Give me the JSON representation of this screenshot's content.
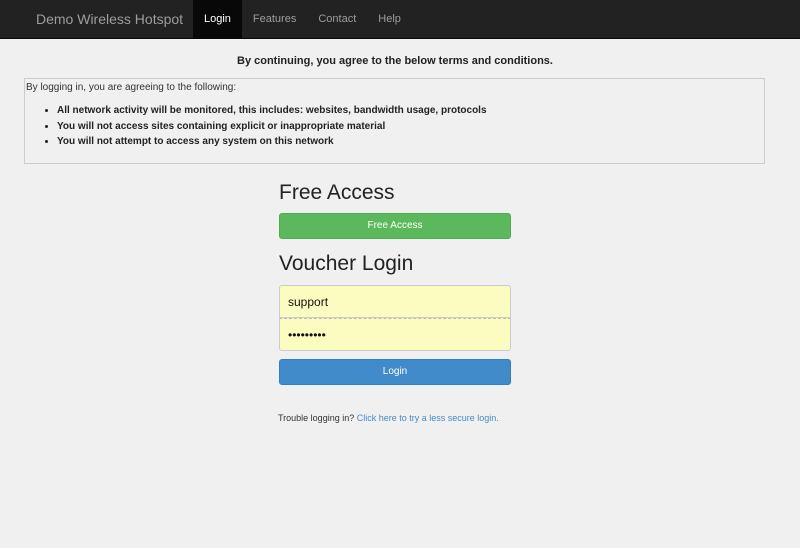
{
  "navbar": {
    "brand": "Demo Wireless Hotspot",
    "items": [
      {
        "label": "Login",
        "active": true
      },
      {
        "label": "Features",
        "active": false
      },
      {
        "label": "Contact",
        "active": false
      },
      {
        "label": "Help",
        "active": false
      }
    ]
  },
  "terms": {
    "heading": "By continuing, you agree to the below terms and conditions.",
    "intro": "By logging in, you are agreeing to the following:",
    "items": [
      "All network activity will be monitored, this includes: websites, bandwidth usage, protocols",
      "You will not access sites containing explicit or inappropriate material",
      "You will not attempt to access any system on this network"
    ]
  },
  "free_access": {
    "title": "Free Access",
    "button_label": "Free Access"
  },
  "voucher": {
    "title": "Voucher Login",
    "username_value": "support",
    "password_value": "supportxx",
    "login_label": "Login"
  },
  "trouble": {
    "text": "Trouble logging in?",
    "link_text": "Click here to try a less secure login."
  },
  "colors": {
    "navbar_bg": "#222222",
    "success": "#5cb85c",
    "primary": "#428bca",
    "input_bg": "#fbfcbf"
  }
}
